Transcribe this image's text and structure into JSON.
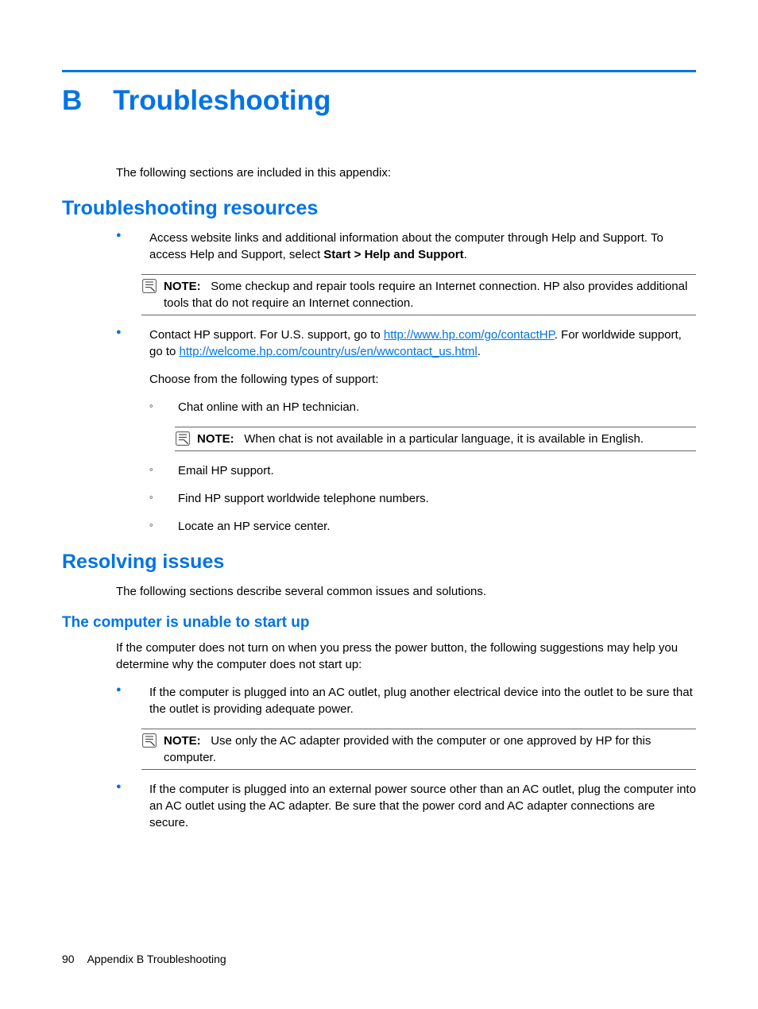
{
  "heading": {
    "appendix_letter": "B",
    "title": "Troubleshooting"
  },
  "intro": "The following sections are included in this appendix:",
  "section1": {
    "title": "Troubleshooting resources",
    "bullet1_pre": "Access website links and additional information about the computer through Help and Support. To access Help and Support, select ",
    "bullet1_bold": "Start > Help and Support",
    "bullet1_post": ".",
    "note1_label": "NOTE:",
    "note1_text": "Some checkup and repair tools require an Internet connection. HP also provides additional tools that do not require an Internet connection.",
    "bullet2_pre": "Contact HP support. For U.S. support, go to ",
    "bullet2_link1": "http://www.hp.com/go/contactHP",
    "bullet2_mid": ". For worldwide support, go to ",
    "bullet2_link2": "http://welcome.hp.com/country/us/en/wwcontact_us.html",
    "bullet2_post": ".",
    "choose": "Choose from the following types of support:",
    "sub1": "Chat online with an HP technician.",
    "note2_label": "NOTE:",
    "note2_text": "When chat is not available in a particular language, it is available in English.",
    "sub2": "Email HP support.",
    "sub3": "Find HP support worldwide telephone numbers.",
    "sub4": "Locate an HP service center."
  },
  "section2": {
    "title": "Resolving issues",
    "intro": "The following sections describe several common issues and solutions.",
    "sub_title": "The computer is unable to start up",
    "para1": "If the computer does not turn on when you press the power button, the following suggestions may help you determine why the computer does not start up:",
    "bullet1": "If the computer is plugged into an AC outlet, plug another electrical device into the outlet to be sure that the outlet is providing adequate power.",
    "note_label": "NOTE:",
    "note_text": "Use only the AC adapter provided with the computer or one approved by HP for this computer.",
    "bullet2": "If the computer is plugged into an external power source other than an AC outlet, plug the computer into an AC outlet using the AC adapter. Be sure that the power cord and AC adapter connections are secure."
  },
  "footer": {
    "page": "90",
    "text": "Appendix B   Troubleshooting"
  }
}
